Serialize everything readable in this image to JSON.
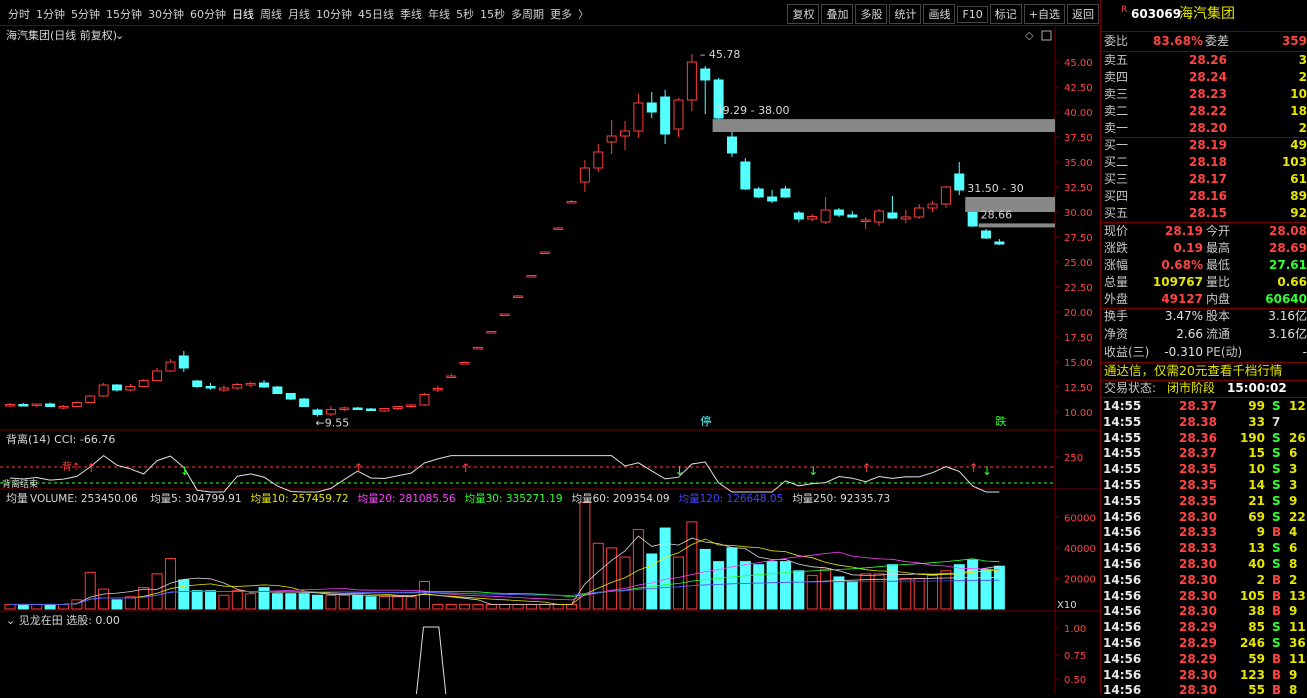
{
  "toolbar": {
    "tabs": [
      "分时",
      "1分钟",
      "5分钟",
      "15分钟",
      "30分钟",
      "60分钟",
      "日线",
      "周线",
      "月线",
      "10分钟",
      "45日线",
      "季线",
      "年线",
      "5秒",
      "15秒",
      "多周期",
      "更多"
    ],
    "active_tab": "日线",
    "more_icon": "chevron-right-icon",
    "actions": [
      "复权",
      "叠加",
      "多股",
      "统计",
      "画线",
      "F10",
      "标记",
      "+自选",
      "返回"
    ]
  },
  "main_chart": {
    "title": "海汽集团(日线 前复权)",
    "title_icon": "chevron-down-icon",
    "diamond_icon": "diamond-icon",
    "settings_icon": "square-icon",
    "y_ticks": [
      "45.00",
      "42.50",
      "40.00",
      "37.50",
      "35.00",
      "32.50",
      "30.00",
      "27.50",
      "25.00",
      "22.50",
      "20.00",
      "17.50",
      "15.00",
      "12.50",
      "10.00"
    ],
    "high_label": "45.78",
    "low_label": "9.55",
    "zone1_label": "39.29 - 38.00",
    "zone2_label": "31.50 - 30",
    "last_label": "28.66",
    "marker_stop": "停",
    "marker_drop": "跌",
    "colors": {
      "up": "#ff3c3c",
      "down": "#54ffff",
      "grid": "#700000",
      "zone": "#888888"
    }
  },
  "cci_panel": {
    "title": "背离(14)",
    "cci_label": "CCI: -66.76",
    "tick": "250",
    "signal_label": "背离",
    "bottom_label": "背离结束",
    "icon": "chevron-down-icon"
  },
  "volume_panel": {
    "title": "均量",
    "items": [
      {
        "text": "VOLUME: 253450.06",
        "color": "#d8d8d8"
      },
      {
        "text": "均量5: 304799.91",
        "color": "#d8d8d8"
      },
      {
        "text": "均量10: 257459.72",
        "color": "#e6e600"
      },
      {
        "text": "均量20: 281085.56",
        "color": "#ff40ff"
      },
      {
        "text": "均量30: 335271.19",
        "color": "#30ff30"
      },
      {
        "text": "均量60: 209354.09",
        "color": "#d8d8d8"
      },
      {
        "text": "均量120: 126648.05",
        "color": "#4040ff"
      },
      {
        "text": "均量250: 92335.73",
        "color": "#d8d8d8"
      }
    ],
    "y_ticks": [
      "60000",
      "40000",
      "20000"
    ],
    "unit": "X10"
  },
  "bottom_panel": {
    "title": "见龙在田",
    "value": "选股: 0.00",
    "y_ticks": [
      "1.00",
      "0.75",
      "0.50"
    ]
  },
  "quote": {
    "badge": "R",
    "code": "603069",
    "name": "海汽集团",
    "weibi_label": "委比",
    "weibi": "83.68%",
    "weicha_label": "委差",
    "weicha": "359",
    "asks": [
      {
        "label": "卖五",
        "price": "28.26",
        "vol": "3"
      },
      {
        "label": "卖四",
        "price": "28.24",
        "vol": "2"
      },
      {
        "label": "卖三",
        "price": "28.23",
        "vol": "10"
      },
      {
        "label": "卖二",
        "price": "28.22",
        "vol": "18"
      },
      {
        "label": "卖一",
        "price": "28.20",
        "vol": "2"
      }
    ],
    "bids": [
      {
        "label": "买一",
        "price": "28.19",
        "vol": "49"
      },
      {
        "label": "买二",
        "price": "28.18",
        "vol": "103"
      },
      {
        "label": "买三",
        "price": "28.17",
        "vol": "61"
      },
      {
        "label": "买四",
        "price": "28.16",
        "vol": "89"
      },
      {
        "label": "买五",
        "price": "28.15",
        "vol": "92"
      }
    ],
    "stats": [
      {
        "l1": "现价",
        "v1": "28.19",
        "c1": "#ff4444",
        "l2": "今开",
        "v2": "28.08",
        "c2": "#ff4444"
      },
      {
        "l1": "涨跌",
        "v1": "0.19",
        "c1": "#ff4444",
        "l2": "最高",
        "v2": "28.69",
        "c2": "#ff4444"
      },
      {
        "l1": "涨幅",
        "v1": "0.68%",
        "c1": "#ff4444",
        "l2": "最低",
        "v2": "27.61",
        "c2": "#30ff30"
      },
      {
        "l1": "总量",
        "v1": "109767",
        "c1": "#e6e600",
        "l2": "量比",
        "v2": "0.66",
        "c2": "#e6e600"
      },
      {
        "l1": "外盘",
        "v1": "49127",
        "c1": "#ff4444",
        "l2": "内盘",
        "v2": "60640",
        "c2": "#30ff30"
      }
    ],
    "stats2": [
      {
        "l1": "换手",
        "v1": "3.47%",
        "l2": "股本",
        "v2": "3.16亿"
      },
      {
        "l1": "净资",
        "v1": "2.66",
        "l2": "流通",
        "v2": "3.16亿"
      },
      {
        "l1": "收益(三)",
        "v1": "-0.310",
        "l2": "PE(动)",
        "v2": "-"
      }
    ],
    "promo": "通达信，仅需20元查看千档行情",
    "status_label": "交易状态:",
    "status_value": "闭市阶段",
    "status_time": "15:00:02"
  },
  "ticks": [
    {
      "t": "14:55",
      "p": "28.37",
      "v": "99",
      "f": "S",
      "x": "12"
    },
    {
      "t": "14:55",
      "p": "28.38",
      "v": "33",
      "f": "7",
      "x": ""
    },
    {
      "t": "14:55",
      "p": "28.36",
      "v": "190",
      "f": "S",
      "x": "26"
    },
    {
      "t": "14:55",
      "p": "28.37",
      "v": "15",
      "f": "S",
      "x": "6"
    },
    {
      "t": "14:55",
      "p": "28.35",
      "v": "10",
      "f": "S",
      "x": "3"
    },
    {
      "t": "14:55",
      "p": "28.35",
      "v": "14",
      "f": "S",
      "x": "3"
    },
    {
      "t": "14:55",
      "p": "28.35",
      "v": "21",
      "f": "S",
      "x": "9"
    },
    {
      "t": "14:56",
      "p": "28.30",
      "v": "69",
      "f": "S",
      "x": "22"
    },
    {
      "t": "14:56",
      "p": "28.33",
      "v": "9",
      "f": "B",
      "x": "4"
    },
    {
      "t": "14:56",
      "p": "28.33",
      "v": "13",
      "f": "S",
      "x": "6"
    },
    {
      "t": "14:56",
      "p": "28.30",
      "v": "40",
      "f": "S",
      "x": "8"
    },
    {
      "t": "14:56",
      "p": "28.30",
      "v": "2",
      "f": "B",
      "x": "2"
    },
    {
      "t": "14:56",
      "p": "28.30",
      "v": "105",
      "f": "B",
      "x": "13"
    },
    {
      "t": "14:56",
      "p": "28.30",
      "v": "38",
      "f": "B",
      "x": "9"
    },
    {
      "t": "14:56",
      "p": "28.29",
      "v": "85",
      "f": "S",
      "x": "11"
    },
    {
      "t": "14:56",
      "p": "28.29",
      "v": "246",
      "f": "S",
      "x": "36"
    },
    {
      "t": "14:56",
      "p": "28.29",
      "v": "59",
      "f": "B",
      "x": "11"
    },
    {
      "t": "14:56",
      "p": "28.30",
      "v": "123",
      "f": "B",
      "x": "9"
    },
    {
      "t": "14:56",
      "p": "28.30",
      "v": "55",
      "f": "B",
      "x": "8"
    }
  ],
  "chart_data": {
    "type": "candlestick",
    "ohlc": [
      [
        10.7,
        10.9,
        10.5,
        10.75
      ],
      [
        10.75,
        10.9,
        10.55,
        10.65
      ],
      [
        10.65,
        10.85,
        10.45,
        10.8
      ],
      [
        10.8,
        10.95,
        10.6,
        10.55
      ],
      [
        10.4,
        10.7,
        10.3,
        10.55
      ],
      [
        10.55,
        11.1,
        10.5,
        10.95
      ],
      [
        10.95,
        11.7,
        10.9,
        11.6
      ],
      [
        11.6,
        12.9,
        11.5,
        12.7
      ],
      [
        12.7,
        12.8,
        12.05,
        12.2
      ],
      [
        12.2,
        12.8,
        12.1,
        12.55
      ],
      [
        12.55,
        13.3,
        12.5,
        13.15
      ],
      [
        13.15,
        14.4,
        13.05,
        14.1
      ],
      [
        14.1,
        15.3,
        14.0,
        15.0
      ],
      [
        15.6,
        16.1,
        14.0,
        14.4
      ],
      [
        13.1,
        13.2,
        12.4,
        12.55
      ],
      [
        12.55,
        12.9,
        12.2,
        12.4
      ],
      [
        12.2,
        12.7,
        12.0,
        12.4
      ],
      [
        12.4,
        12.9,
        12.2,
        12.75
      ],
      [
        12.75,
        13.0,
        12.5,
        12.85
      ],
      [
        12.9,
        13.2,
        12.4,
        12.5
      ],
      [
        12.5,
        12.6,
        11.8,
        11.85
      ],
      [
        11.85,
        11.9,
        11.2,
        11.3
      ],
      [
        11.3,
        11.4,
        10.5,
        10.55
      ],
      [
        10.2,
        10.35,
        9.55,
        9.75
      ],
      [
        9.8,
        10.6,
        9.6,
        10.25
      ],
      [
        10.25,
        10.55,
        10.1,
        10.4
      ],
      [
        10.4,
        10.5,
        10.25,
        10.35
      ],
      [
        10.3,
        10.4,
        10.15,
        10.25
      ],
      [
        10.1,
        10.4,
        10.0,
        10.35
      ],
      [
        10.35,
        10.6,
        10.2,
        10.55
      ],
      [
        10.55,
        10.8,
        10.4,
        10.7
      ],
      [
        10.7,
        11.9,
        10.6,
        11.75
      ],
      [
        12.2,
        12.6,
        12.0,
        12.35
      ],
      [
        13.55,
        13.85,
        13.45,
        13.6
      ],
      [
        14.9,
        15.05,
        14.8,
        14.95
      ],
      [
        16.4,
        16.55,
        16.3,
        16.45
      ],
      [
        17.95,
        18.1,
        17.85,
        18.05
      ],
      [
        19.75,
        19.85,
        19.6,
        19.8
      ],
      [
        21.55,
        21.7,
        21.45,
        21.6
      ],
      [
        23.55,
        23.7,
        23.45,
        23.65
      ],
      [
        25.95,
        26.05,
        25.85,
        26.0
      ],
      [
        28.35,
        28.5,
        28.25,
        28.4
      ],
      [
        31.0,
        31.2,
        30.9,
        31.05
      ],
      [
        33.0,
        35.2,
        32.0,
        34.4
      ],
      [
        34.4,
        36.8,
        34.0,
        36.0
      ],
      [
        37.0,
        39.2,
        35.8,
        37.6
      ],
      [
        37.6,
        39.1,
        36.2,
        38.1
      ],
      [
        38.1,
        41.8,
        37.4,
        40.9
      ],
      [
        40.9,
        42.0,
        39.4,
        40.0
      ],
      [
        41.5,
        42.2,
        36.8,
        37.8
      ],
      [
        38.3,
        41.4,
        37.5,
        41.2
      ],
      [
        41.2,
        45.78,
        40.1,
        45.0
      ],
      [
        44.3,
        44.6,
        39.8,
        43.2
      ],
      [
        43.2,
        43.4,
        38.0,
        39.4
      ],
      [
        37.5,
        38.2,
        35.5,
        35.9
      ],
      [
        35.0,
        35.4,
        32.2,
        32.3
      ],
      [
        32.3,
        32.5,
        31.4,
        31.5
      ],
      [
        31.5,
        32.2,
        30.9,
        31.1
      ],
      [
        32.3,
        32.6,
        31.4,
        31.5
      ],
      [
        29.9,
        30.1,
        29.0,
        29.3
      ],
      [
        29.3,
        29.8,
        29.1,
        29.55
      ],
      [
        29.0,
        31.5,
        28.8,
        30.2
      ],
      [
        30.2,
        30.4,
        29.5,
        29.7
      ],
      [
        29.7,
        30.1,
        29.4,
        29.5
      ],
      [
        29.1,
        29.5,
        28.3,
        29.2
      ],
      [
        29.0,
        30.3,
        28.6,
        30.1
      ],
      [
        29.9,
        31.6,
        29.3,
        29.4
      ],
      [
        29.3,
        30.2,
        28.9,
        29.5
      ],
      [
        29.5,
        30.8,
        29.3,
        30.4
      ],
      [
        30.4,
        31.1,
        30.0,
        30.8
      ],
      [
        30.8,
        32.6,
        30.4,
        32.5
      ],
      [
        33.8,
        35.0,
        31.7,
        32.2
      ],
      [
        30.3,
        30.6,
        28.5,
        28.6
      ],
      [
        28.1,
        28.3,
        27.3,
        27.4
      ],
      [
        27.0,
        27.3,
        26.7,
        26.8
      ]
    ],
    "volume": [
      3,
      3,
      3,
      3,
      3,
      6,
      24,
      13,
      6,
      8,
      14,
      23,
      33,
      19,
      12,
      12,
      9,
      12,
      10,
      14,
      10,
      10,
      10,
      9,
      9,
      9,
      9,
      8,
      8,
      8,
      8,
      18,
      3,
      3,
      3,
      3,
      3,
      3,
      3,
      3,
      3,
      3,
      3,
      70,
      43,
      40,
      34,
      52,
      36,
      53,
      34,
      57,
      39,
      31,
      40,
      31,
      29,
      31,
      31,
      25,
      22,
      26,
      21,
      18,
      23,
      23,
      29,
      20,
      20,
      22,
      25,
      29,
      32,
      26,
      28
    ],
    "price_ylim": [
      8.5,
      46.5
    ],
    "volume_ylim": [
      0,
      72000
    ],
    "volume_unit": "X10"
  }
}
